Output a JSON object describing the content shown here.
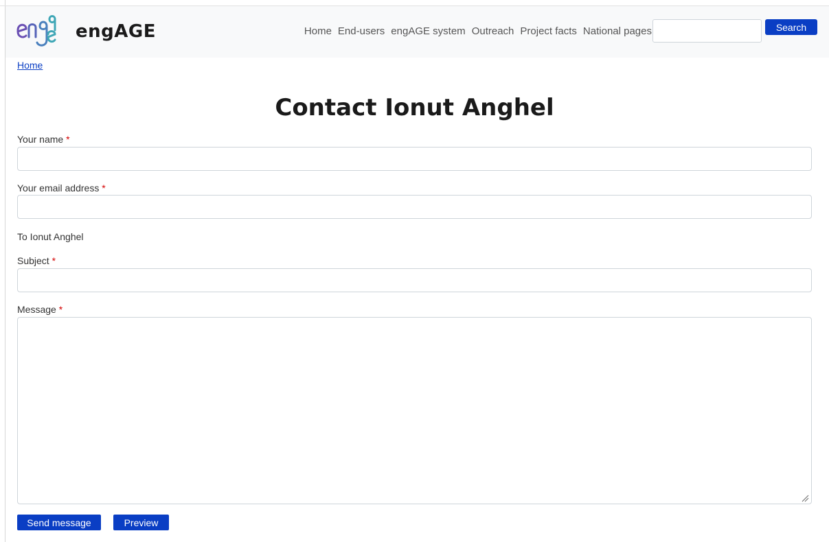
{
  "header": {
    "site_name": "engAGE",
    "nav": [
      "Home",
      "End-users",
      "engAGE system",
      "Outreach",
      "Project facts",
      "National pages"
    ],
    "search": {
      "value": "",
      "button_label": "Search"
    },
    "colors": {
      "accent": "#0a3ec4",
      "logo_purple": "#6a4fb3",
      "logo_teal": "#3fa7b6"
    }
  },
  "breadcrumb": {
    "home": "Home"
  },
  "page": {
    "title": "Contact Ionut Anghel"
  },
  "form": {
    "name_label": "Your name",
    "email_label": "Your email address",
    "recipient_text": "To Ionut Anghel",
    "subject_label": "Subject",
    "message_label": "Message",
    "required_mark": "*",
    "name_value": "",
    "email_value": "",
    "subject_value": "",
    "message_value": ""
  },
  "actions": {
    "send_label": "Send message",
    "preview_label": "Preview"
  }
}
